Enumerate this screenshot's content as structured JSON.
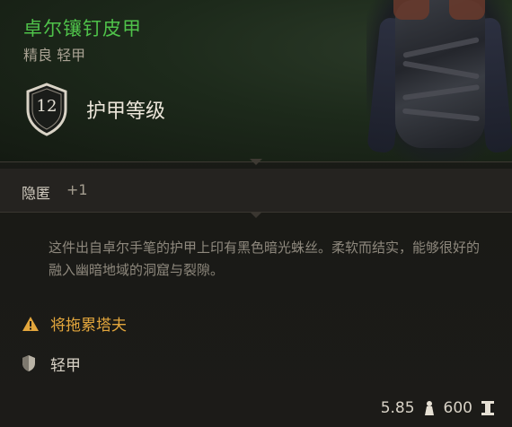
{
  "item": {
    "name": "卓尔镶钉皮甲",
    "rarity_type": "精良 轻甲",
    "armor_class_value": "12",
    "armor_class_label": "护甲等级"
  },
  "stealth": {
    "label": "隐匿",
    "value": "+1"
  },
  "description": "这件出自卓尔手笔的护甲上印有黑色暗光蛛丝。柔软而结实，能够很好的融入幽暗地域的洞窟与裂隙。",
  "properties": [
    {
      "icon": "warning-icon",
      "text": "将拖累塔夫",
      "color": "#e3a63c"
    },
    {
      "icon": "light-armor-icon",
      "text": "轻甲",
      "color": "#d8d2c6"
    }
  ],
  "footer": {
    "weight": "5.85",
    "weight_icon": "weight-icon",
    "price": "600",
    "price_icon": "gold-icon"
  },
  "colors": {
    "item_name": "#4fc24a",
    "warning": "#e3a63c"
  }
}
